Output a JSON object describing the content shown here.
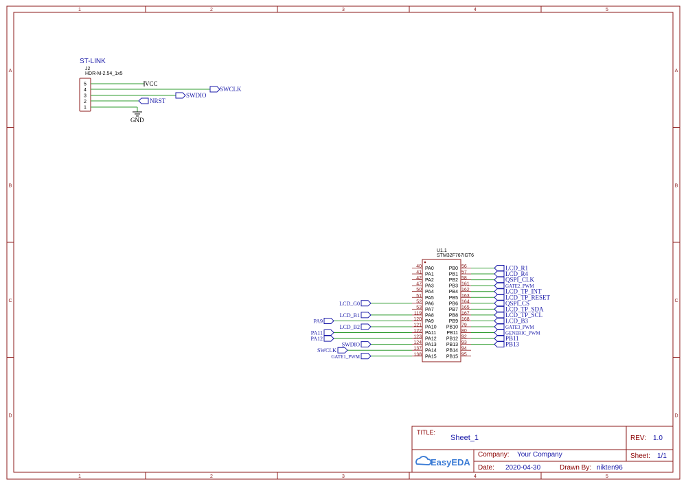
{
  "frame": {
    "columns": [
      "1",
      "2",
      "3",
      "4",
      "5"
    ],
    "rows": [
      "A",
      "B",
      "C",
      "D"
    ],
    "border_color": "#8b1a1a",
    "wire_color": "#2e9b2e",
    "net_color": "#1a1aa8"
  },
  "stlink": {
    "title": "ST-LINK",
    "designator": "J2",
    "footprint": "HDR-M-2.54_1x5",
    "pins": [
      "5",
      "4",
      "3",
      "2",
      "1"
    ],
    "vcc": "VCC",
    "gnd": "GND",
    "nets": {
      "swclk": "SWCLK",
      "swdio": "SWDIO",
      "nrst": "NRST"
    }
  },
  "mcu": {
    "designator": "U1.1",
    "part": "STM32F767IGT6",
    "left_pins": [
      {
        "num": "40",
        "name": "PA0",
        "net": ""
      },
      {
        "num": "41",
        "name": "PA1",
        "net": ""
      },
      {
        "num": "42",
        "name": "PA2",
        "net": ""
      },
      {
        "num": "47",
        "name": "PA3",
        "net": ""
      },
      {
        "num": "50",
        "name": "PA4",
        "net": ""
      },
      {
        "num": "51",
        "name": "PA5",
        "net": ""
      },
      {
        "num": "52",
        "name": "PA6",
        "net": "LCD_G0"
      },
      {
        "num": "53",
        "name": "PA7",
        "net": ""
      },
      {
        "num": "119",
        "name": "PA8",
        "net": "LCD_B1"
      },
      {
        "num": "120",
        "name": "PA9",
        "net": "PA9"
      },
      {
        "num": "121",
        "name": "PA10",
        "net": "LCD_B2"
      },
      {
        "num": "122",
        "name": "PA11",
        "net": "PA11"
      },
      {
        "num": "123",
        "name": "PA12",
        "net": "PA12"
      },
      {
        "num": "124",
        "name": "PA13",
        "net": "SWDIO"
      },
      {
        "num": "137",
        "name": "PA14",
        "net": "SWCLK"
      },
      {
        "num": "138",
        "name": "PA15",
        "net": "GATE1_PWM"
      }
    ],
    "right_pins": [
      {
        "num": "56",
        "name": "PB0",
        "net": "LCD_R1"
      },
      {
        "num": "57",
        "name": "PB1",
        "net": "LCD_R4"
      },
      {
        "num": "58",
        "name": "PB2",
        "net": "QSPI_CLK"
      },
      {
        "num": "161",
        "name": "PB3",
        "net": "GATE2_PWM"
      },
      {
        "num": "162",
        "name": "PB4",
        "net": "LCD_TP_INT"
      },
      {
        "num": "163",
        "name": "PB5",
        "net": "LCD_TP_RESET"
      },
      {
        "num": "164",
        "name": "PB6",
        "net": "QSPI_CS"
      },
      {
        "num": "165",
        "name": "PB7",
        "net": "LCD_TP_SDA"
      },
      {
        "num": "167",
        "name": "PB8",
        "net": "LCD_TP_SCL"
      },
      {
        "num": "168",
        "name": "PB9",
        "net": "LCD_B3"
      },
      {
        "num": "79",
        "name": "PB10",
        "net": "GATE3_PWM"
      },
      {
        "num": "80",
        "name": "PB11",
        "net": "GENERIC_PWM"
      },
      {
        "num": "92",
        "name": "PB12",
        "net": "PB11"
      },
      {
        "num": "93",
        "name": "PB13",
        "net": "PB13"
      },
      {
        "num": "94",
        "name": "PB14",
        "net": ""
      },
      {
        "num": "95",
        "name": "PB15",
        "net": ""
      }
    ]
  },
  "title_block": {
    "title_label": "TITLE:",
    "title": "Sheet_1",
    "rev_label": "REV:",
    "rev": "1.0",
    "company_label": "Company:",
    "company": "Your Company",
    "sheet_label": "Sheet:",
    "sheet": "1/1",
    "date_label": "Date:",
    "date": "2020-04-30",
    "drawn_label": "Drawn By:",
    "drawn_by": "nikten96",
    "logo": "EasyEDA"
  }
}
